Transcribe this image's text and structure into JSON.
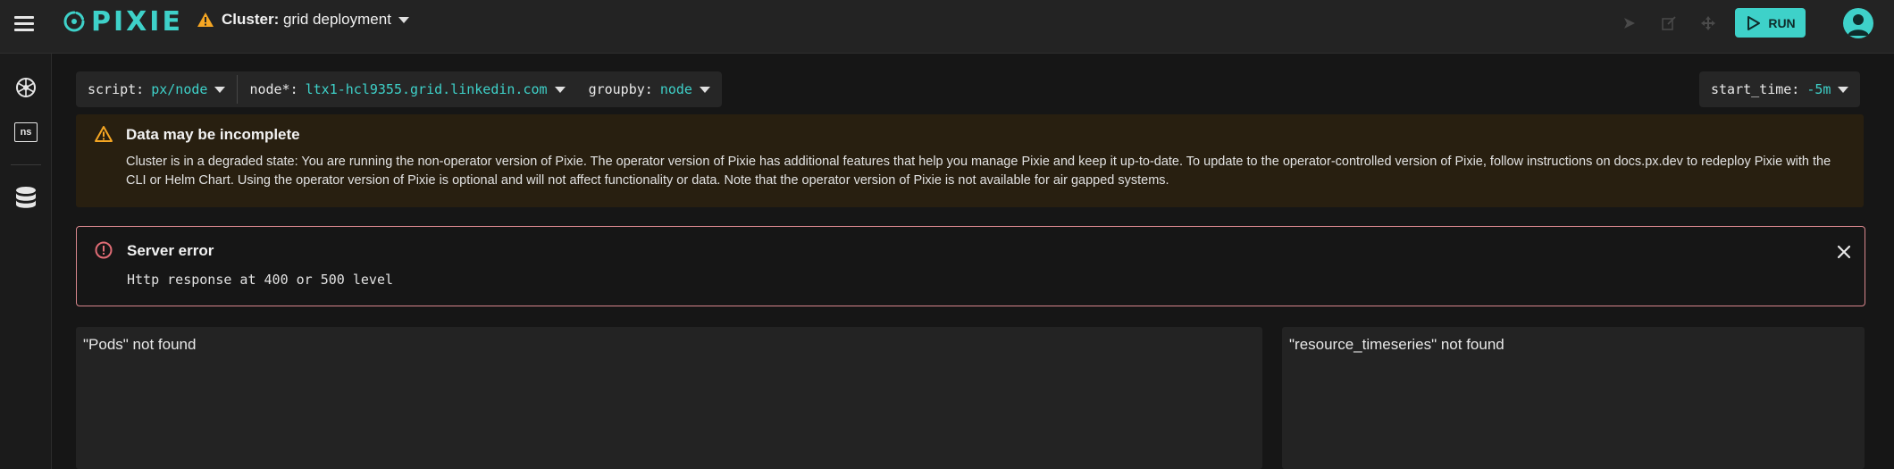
{
  "app": {
    "name": "PIXIE"
  },
  "header": {
    "cluster_label": "Cluster:",
    "cluster_name": "grid deployment",
    "run_label": "RUN",
    "accent": "#3ed1c9",
    "icons": [
      "play-icon",
      "edit-icon",
      "move-icon"
    ]
  },
  "sidebar": {
    "items": [
      {
        "name": "kubernetes-icon"
      },
      {
        "name": "namespace-icon",
        "label": "ns"
      },
      {
        "name": "database-icon"
      }
    ]
  },
  "args": {
    "script": {
      "key": "script:",
      "value": "px/node"
    },
    "node": {
      "key": "node*:",
      "value": "ltx1-hcl9355.grid.linkedin.com"
    },
    "groupby": {
      "key": "groupby:",
      "value": "node"
    },
    "start_time": {
      "key": "start_time:",
      "value": "-5m"
    }
  },
  "warning": {
    "title": "Data may be incomplete",
    "body": "Cluster is in a degraded state: You are running the non-operator version of Pixie. The operator version of Pixie has additional features that help you manage Pixie and keep it up-to-date. To update to the operator-controlled version of Pixie, follow instructions on docs.px.dev to redeploy Pixie with the CLI or Helm Chart. Using the operator version of Pixie is optional and will not affect functionality or data. Note that the operator version of Pixie is not available for air gapped systems.",
    "color": "#f5a623"
  },
  "error": {
    "title": "Server error",
    "body": "Http response at 400 or 500 level",
    "color": "#e06c75"
  },
  "panels": {
    "left_message": "\"Pods\" not found",
    "right_message": "\"resource_timeseries\" not found"
  }
}
